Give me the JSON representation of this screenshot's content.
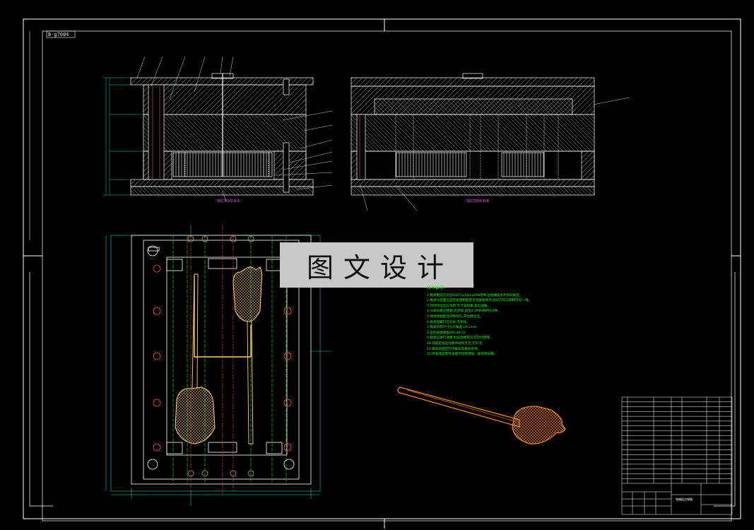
{
  "drawing_number": "B-g7004",
  "watermark": "图文设计",
  "sections": {
    "left_label": "SECTION A-A",
    "right_label": "SECTION B-B"
  },
  "tech_requirements": {
    "title": "技术要求:",
    "lines": [
      "1.模具制造应符合GB/T12554-2006塑料注射模技术条件的规定。",
      "2.模具分型面与型腔表面粗糙度符合图纸要求,抛光方向与脱模方向一致。",
      "3.顶杆顶出后应平稳,无卡滞现象,复位准确。",
      "4.冷却水路应畅通,无渗漏,试压0.5MPa保持5分钟。",
      "5.导柱导套配合间隙均匀,开合模灵活。",
      "6.各紧固螺钉应拧紧,无松动。",
      "7.模具外形尺寸允许偏差±0.1mm",
      "8.型腔表面硬度HRC48-52",
      "9.模具应进行试模,制品合格后方可交付使用。",
      "10.装配后各运动部件动作灵活,无干涉。",
      "11.模具表面应打印编号及模具名称。",
      "12.所有成型零件表面不得有锈蚀、碰伤和划痕。"
    ]
  },
  "title_block": {
    "title_text": "苍蝇拍注塑模",
    "rows": 18
  },
  "colors": {
    "outline": "#ffffff",
    "hatch": "#ffffff",
    "centerline": "#ff3030",
    "guide": "#00c000",
    "dimension": "#00c8c8",
    "part": "#ffd060",
    "part_3d": "#ff8c00",
    "notes": "#00ff00",
    "leader": "#ff00ff"
  }
}
